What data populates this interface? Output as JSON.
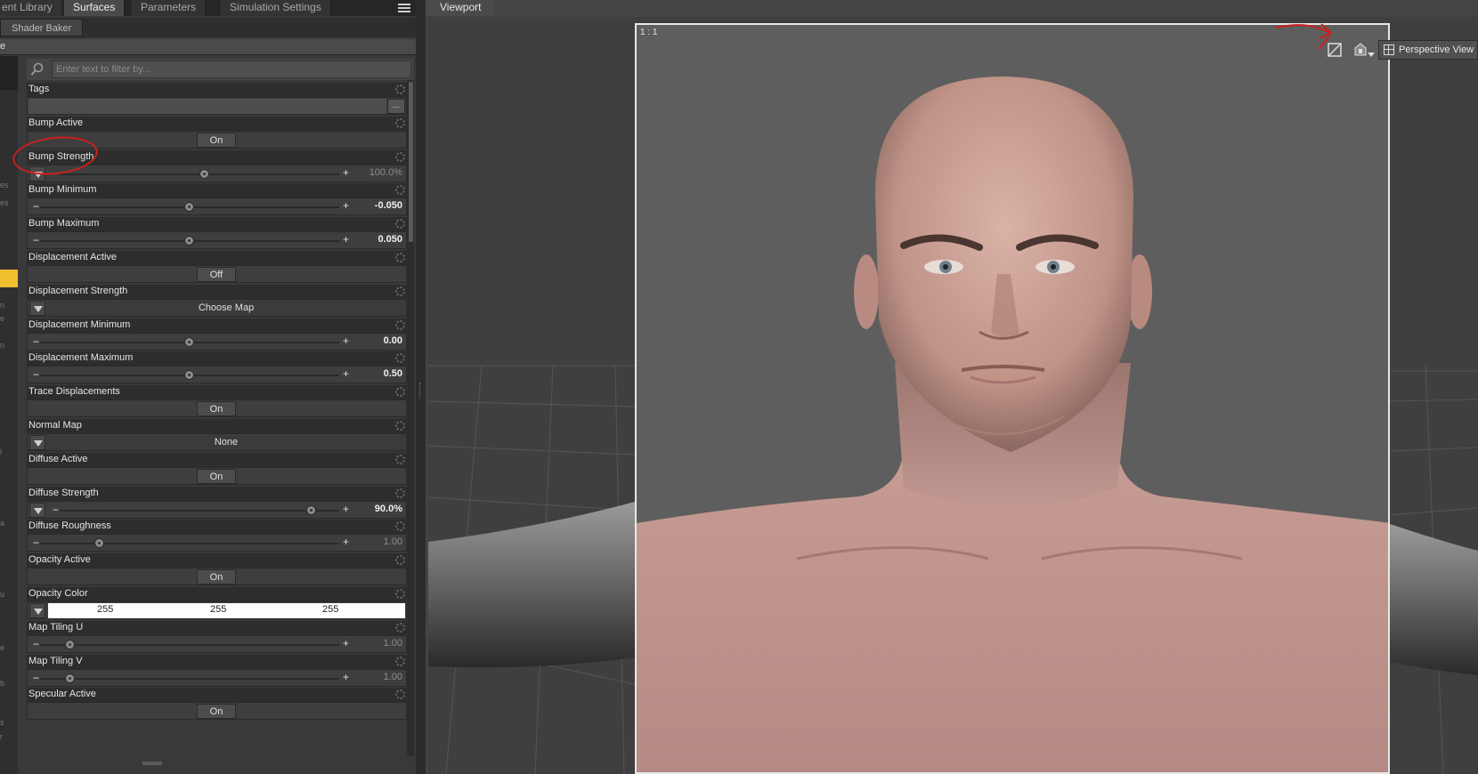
{
  "tabs": [
    {
      "label": "ent Library",
      "active": false
    },
    {
      "label": "Surfaces",
      "active": true
    },
    {
      "label": "Parameters",
      "active": false
    },
    {
      "label": "Simulation Settings",
      "active": false
    }
  ],
  "subtabs": {
    "shader_baker": "Shader Baker"
  },
  "header_strip": {
    "label": "e"
  },
  "tree_fragments": [
    "es",
    "es",
    "n",
    "e",
    "n",
    "l",
    "a",
    "u",
    "e",
    "b",
    "s",
    "r"
  ],
  "filter": {
    "placeholder": "Enter text to filter by..."
  },
  "properties": [
    {
      "label": "Tags",
      "kind": "tags"
    },
    {
      "label": "Bump Active",
      "kind": "toggle",
      "value": "On"
    },
    {
      "label": "Bump Strength",
      "kind": "slider",
      "value": "100.0%",
      "fraction": 0.52,
      "dim": true,
      "expand": true
    },
    {
      "label": "Bump Minimum",
      "kind": "slider",
      "value": "-0.050",
      "fraction": 0.5
    },
    {
      "label": "Bump Maximum",
      "kind": "slider",
      "value": "0.050",
      "fraction": 0.5
    },
    {
      "label": "Displacement Active",
      "kind": "toggle",
      "value": "Off"
    },
    {
      "label": "Displacement Strength",
      "kind": "map",
      "value": "Choose Map"
    },
    {
      "label": "Displacement Minimum",
      "kind": "slider",
      "value": "0.00",
      "fraction": 0.5
    },
    {
      "label": "Displacement Maximum",
      "kind": "slider",
      "value": "0.50",
      "fraction": 0.5
    },
    {
      "label": "Trace Displacements",
      "kind": "toggle",
      "value": "On"
    },
    {
      "label": "Normal Map",
      "kind": "map",
      "value": "None"
    },
    {
      "label": "Diffuse Active",
      "kind": "toggle",
      "value": "On"
    },
    {
      "label": "Diffuse Strength",
      "kind": "slider",
      "value": "90.0%",
      "fraction": 0.9,
      "expand": true
    },
    {
      "label": "Diffuse Roughness",
      "kind": "slider",
      "value": "1.00",
      "fraction": 0.2,
      "dim": true
    },
    {
      "label": "Opacity Active",
      "kind": "toggle",
      "value": "On"
    },
    {
      "label": "Opacity Color",
      "kind": "color",
      "values": [
        "255",
        "255",
        "255"
      ]
    },
    {
      "label": "Map Tiling U",
      "kind": "slider",
      "value": "1.00",
      "fraction": 0.1,
      "dim": true
    },
    {
      "label": "Map Tiling V",
      "kind": "slider",
      "value": "1.00",
      "fraction": 0.1,
      "dim": true
    },
    {
      "label": "Specular Active",
      "kind": "toggle",
      "value": "On"
    }
  ],
  "viewport": {
    "tab_label": "Viewport",
    "frame_label": "1 : 1",
    "camera_label": "Perspective View",
    "icons": [
      "frame-toggle-icon",
      "camera-icon",
      "perspective-icon"
    ]
  },
  "colors": {
    "annotation_red": "#cc1f1f",
    "selected_tree_item": "#f0c030",
    "frame_border": "#e8e8e8"
  }
}
